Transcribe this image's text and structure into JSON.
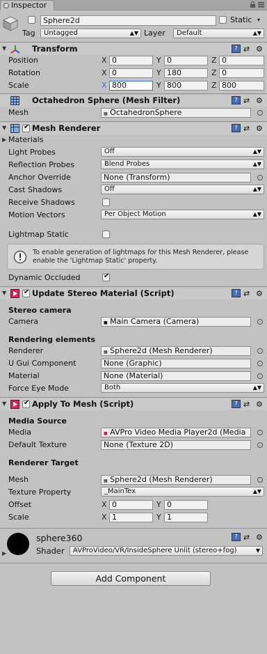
{
  "window": {
    "tab_label": "Inspector"
  },
  "object": {
    "name": "Sphere2d",
    "static_label": "Static",
    "tag_label": "Tag",
    "tag_value": "Untagged",
    "layer_label": "Layer",
    "layer_value": "Default"
  },
  "transform": {
    "title": "Transform",
    "position_label": "Position",
    "rotation_label": "Rotation",
    "scale_label": "Scale",
    "axis_x": "X",
    "axis_y": "Y",
    "axis_z": "Z",
    "position": [
      "0",
      "0",
      "0"
    ],
    "rotation": [
      "0",
      "180",
      "0"
    ],
    "scale": [
      "800",
      "800",
      "800"
    ]
  },
  "mesh_filter": {
    "title": "Octahedron Sphere (Mesh Filter)",
    "mesh_label": "Mesh",
    "mesh_value": "OctahedronSphere"
  },
  "mesh_renderer": {
    "title": "Mesh Renderer",
    "materials_label": "Materials",
    "light_probes_label": "Light Probes",
    "light_probes_value": "Off",
    "reflection_probes_label": "Reflection Probes",
    "reflection_probes_value": "Blend Probes",
    "anchor_override_label": "Anchor Override",
    "anchor_override_value": "None (Transform)",
    "cast_shadows_label": "Cast Shadows",
    "cast_shadows_value": "Off",
    "receive_shadows_label": "Receive Shadows",
    "motion_vectors_label": "Motion Vectors",
    "motion_vectors_value": "Per Object Motion",
    "lightmap_static_label": "Lightmap Static",
    "info_text": "To enable generation of lightmaps for this Mesh Renderer, please enable the 'Lightmap Static' property.",
    "dynamic_occluded_label": "Dynamic Occluded"
  },
  "update_stereo": {
    "title": "Update Stereo Material (Script)",
    "stereo_camera_heading": "Stereo camera",
    "camera_label": "Camera",
    "camera_value": "Main Camera (Camera)",
    "rendering_heading": "Rendering elements",
    "renderer_label": "Renderer",
    "renderer_value": "Sphere2d (Mesh Renderer)",
    "ugui_label": "U Gui Component",
    "ugui_value": "None (Graphic)",
    "material_label": "Material",
    "material_value": "None (Material)",
    "force_eye_label": "Force Eye Mode",
    "force_eye_value": "Both"
  },
  "apply_to_mesh": {
    "title": "Apply To Mesh (Script)",
    "media_source_heading": "Media Source",
    "media_label": "Media",
    "media_value": "AVPro Video Media Player2d (Media",
    "default_texture_label": "Default Texture",
    "default_texture_value": "None (Texture 2D)",
    "renderer_target_heading": "Renderer Target",
    "mesh_label": "Mesh",
    "mesh_value": "Sphere2d (Mesh Renderer)",
    "texture_property_label": "Texture Property",
    "texture_property_value": "_MainTex",
    "offset_label": "Offset",
    "offset": [
      "0",
      "0"
    ],
    "scale_label": "Scale",
    "scale": [
      "1",
      "1"
    ]
  },
  "material": {
    "name": "sphere360",
    "shader_label": "Shader",
    "shader_value": "AVProVideo/VR/InsideSphere Unlit (stereo+fog)"
  },
  "add_component_label": "Add Component"
}
